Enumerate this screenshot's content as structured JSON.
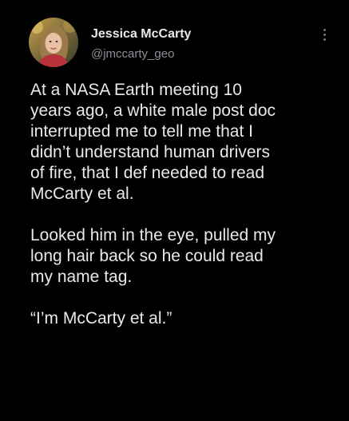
{
  "author": {
    "display_name": "Jessica McCarty",
    "handle": "@jmccarty_geo"
  },
  "tweet": {
    "paragraphs": [
      "At a NASA Earth meeting 10\nyears ago, a white male post doc\ninterrupted me to tell me that I\ndidn’t understand human drivers\nof fire, that I def needed to read\nMcCarty et al.",
      "Looked him in the eye, pulled my\nlong hair back so he could read\nmy name tag.",
      "“I’m McCarty et al.”"
    ]
  },
  "icons": {
    "more": "more-vertical-icon"
  },
  "colors": {
    "background": "#000000",
    "text_primary": "#e7e9ea",
    "text_secondary": "#8b9096"
  }
}
